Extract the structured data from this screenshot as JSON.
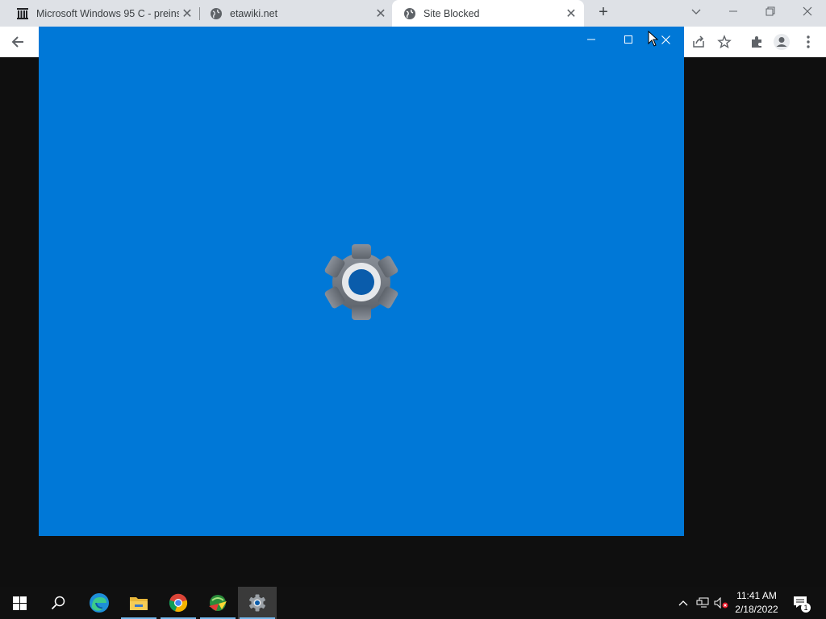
{
  "browser": {
    "tabs": [
      {
        "title": "Microsoft Windows 95 C - preins",
        "favicon": "archive-icon",
        "active": false
      },
      {
        "title": "etawiki.net",
        "favicon": "globe-icon",
        "active": false
      },
      {
        "title": "Site Blocked",
        "favicon": "globe-icon",
        "active": true
      }
    ],
    "new_tab_label": "+",
    "tab_close_glyph": "✕"
  },
  "app_window": {
    "background_color": "#0078d7",
    "center_icon": "gear-icon"
  },
  "taskbar": {
    "apps": [
      "start-icon",
      "search-icon",
      "edge-icon",
      "file-explorer-icon",
      "chrome-icon",
      "network-app-icon",
      "settings-icon"
    ],
    "time": "11:41 AM",
    "date": "2/18/2022",
    "notification_count": "1"
  },
  "colors": {
    "tabstrip": "#dee1e6",
    "taskbar": "#101010",
    "accent_blue": "#0078d7"
  }
}
